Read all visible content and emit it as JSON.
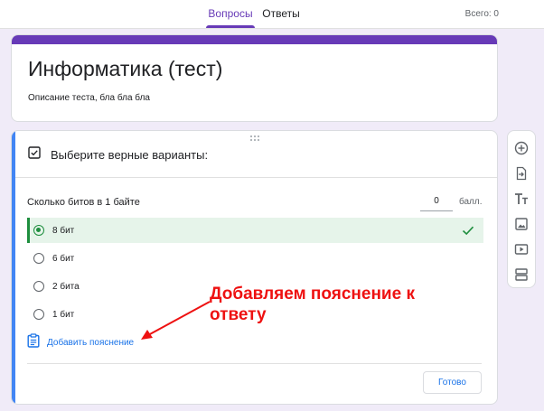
{
  "tabs": {
    "questions": "Вопросы",
    "answers": "Ответы",
    "total": "Всего: 0"
  },
  "form": {
    "title": "Информатика (тест)",
    "description": "Описание теста, бла бла бла"
  },
  "section": {
    "title": "Выберите верные варианты:"
  },
  "question": {
    "text": "Сколько битов в 1 байте",
    "points": "0",
    "points_label": "балл.",
    "options": [
      {
        "label": "8 бит",
        "correct": true
      },
      {
        "label": "6 бит",
        "correct": false
      },
      {
        "label": "2 бита",
        "correct": false
      },
      {
        "label": "1 бит",
        "correct": false
      }
    ],
    "add_explanation": "Добавить пояснение",
    "done": "Готово"
  },
  "toolbar": {
    "icons": [
      "add-question-icon",
      "import-questions-icon",
      "add-title-icon",
      "add-image-icon",
      "add-video-icon",
      "add-section-icon"
    ]
  },
  "annotation": {
    "line1": "Добавляем пояснение к",
    "line2": "ответу",
    "color": "#ee1111"
  },
  "colors": {
    "accent": "#673ab7",
    "focus": "#4285f4",
    "correct": "#1e8e3e",
    "link": "#1a73e8"
  }
}
